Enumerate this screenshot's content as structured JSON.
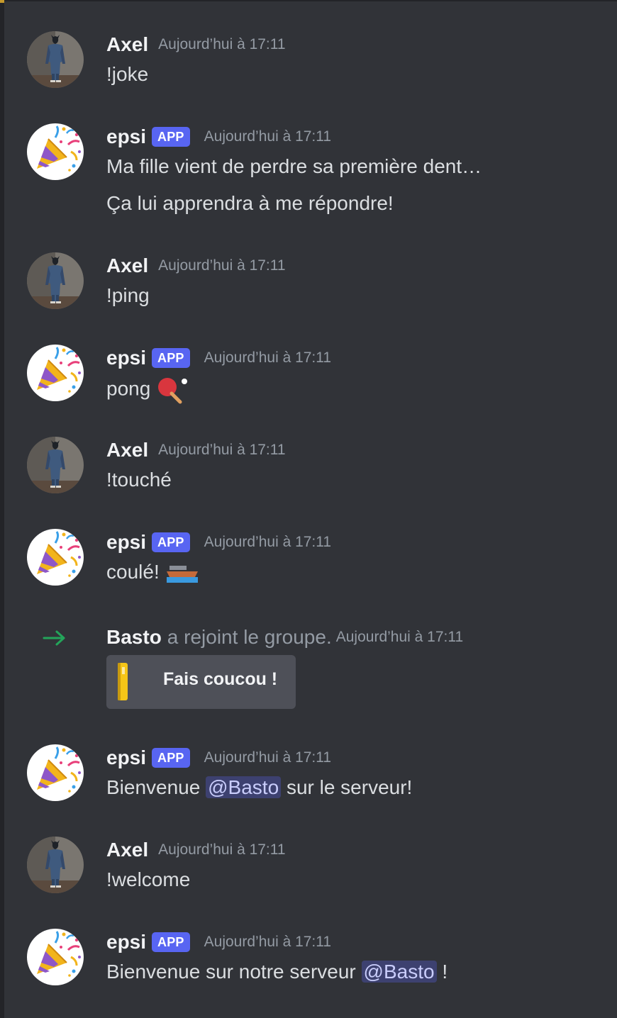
{
  "colors": {
    "background": "#313338",
    "app_badge": "#5865f2",
    "join_arrow": "#23a55a",
    "mention_bg": "#3c4270"
  },
  "messages": [
    {
      "kind": "user",
      "author": "Axel",
      "avatar": "batman-figure-avatar",
      "timestamp": "Aujourd’hui à 17:11",
      "lines": [
        "!joke"
      ]
    },
    {
      "kind": "bot",
      "author": "epsi",
      "badge": "APP",
      "avatar": "party-popper-avatar",
      "timestamp": "Aujourd’hui à 17:11",
      "lines": [
        "Ma fille vient de perdre sa première dent…",
        "Ça lui apprendra à me répondre!"
      ]
    },
    {
      "kind": "user",
      "author": "Axel",
      "avatar": "batman-figure-avatar",
      "timestamp": "Aujourd’hui à 17:11",
      "lines": [
        "!ping"
      ]
    },
    {
      "kind": "bot",
      "author": "epsi",
      "badge": "APP",
      "avatar": "party-popper-avatar",
      "timestamp": "Aujourd’hui à 17:11",
      "text": "pong",
      "emoji": "ping-pong-icon"
    },
    {
      "kind": "user",
      "author": "Axel",
      "avatar": "batman-figure-avatar",
      "timestamp": "Aujourd’hui à 17:11",
      "lines": [
        "!touché"
      ]
    },
    {
      "kind": "bot",
      "author": "epsi",
      "badge": "APP",
      "avatar": "party-popper-avatar",
      "timestamp": "Aujourd’hui à 17:11",
      "text": "coulé!",
      "emoji": "boat-icon"
    },
    {
      "kind": "join",
      "author": "Basto",
      "text": "a rejoint le groupe.",
      "timestamp": "Aujourd’hui à 17:11",
      "button_label": "Fais coucou !"
    },
    {
      "kind": "bot",
      "author": "epsi",
      "badge": "APP",
      "avatar": "party-popper-avatar",
      "timestamp": "Aujourd’hui à 17:11",
      "before": "Bienvenue",
      "mention": "@Basto",
      "after": "sur le serveur!"
    },
    {
      "kind": "user",
      "author": "Axel",
      "avatar": "batman-figure-avatar",
      "timestamp": "Aujourd’hui à 17:11",
      "lines": [
        "!welcome"
      ]
    },
    {
      "kind": "bot",
      "author": "epsi",
      "badge": "APP",
      "avatar": "party-popper-avatar",
      "timestamp": "Aujourd’hui à 17:11",
      "before": "Bienvenue sur notre serveur",
      "mention": "@Basto",
      "after": "!"
    }
  ]
}
